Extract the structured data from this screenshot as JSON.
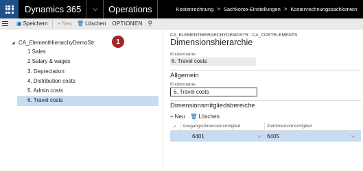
{
  "topbar": {
    "app_name": "Dynamics 365",
    "module": "Operations",
    "breadcrumbs": [
      "Kostenrechnung",
      "Sachkonto-Einstellungen",
      "Kostenrechnungssachkonten"
    ]
  },
  "actionbar": {
    "save": "Speichern",
    "new": "Neu",
    "delete": "Löschen",
    "options": "OPTIONEN"
  },
  "tree": {
    "root": "CA_ElementHierarchyDemoStr",
    "items": [
      "1 Sales",
      "2 Salary & wages",
      "3. Depreciation",
      "4. Distribution costs",
      "5. Admin costs",
      "6. Travel costs"
    ],
    "selected_index": 5
  },
  "badge": "1",
  "detail": {
    "caption": "CA_ELEMENTHIERARCHYDEMOSTR : CA_COSTELEMENTS",
    "title": "Dimensionshierarchie",
    "node_label": "Knotenname",
    "node_value": "6. Travel costs",
    "general": {
      "heading": "Allgemein",
      "label": "Knotenname",
      "value": "6. Travel costs"
    },
    "ranges": {
      "heading": "Dimensionsmitgliedsbereiche",
      "new": "Neu",
      "delete": "Löschen",
      "col_from": "Ausgangsdimensionsmitglied",
      "col_to": "Zieldimensionsmitglied",
      "rows": [
        {
          "from": "6401",
          "to": "6405"
        }
      ]
    }
  },
  "colors": {
    "topbar": "#000000",
    "waffle": "#1f4f8a",
    "selection": "#c7dcf0",
    "accent": "#0063b1",
    "badge": "#a4262c"
  }
}
